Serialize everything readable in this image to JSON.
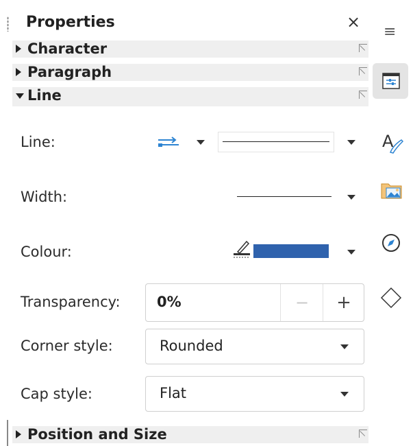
{
  "panel": {
    "title": "Properties",
    "close_label": "×"
  },
  "sections": {
    "character": "Character",
    "paragraph": "Paragraph",
    "line": "Line",
    "position_size": "Position and Size"
  },
  "line": {
    "line_label": "Line:",
    "width_label": "Width:",
    "colour_label": "Colour:",
    "colour_value": "#2f62ad",
    "transparency_label": "Transparency:",
    "transparency_value": "0%",
    "corner_label": "Corner style:",
    "corner_value": "Rounded",
    "cap_label": "Cap style:",
    "cap_value": "Flat"
  },
  "sidebar": {
    "menu_glyph": "≡",
    "icons": [
      "properties-icon",
      "styles-icon",
      "gallery-icon",
      "navigator-icon",
      "shapes-icon"
    ]
  },
  "colors": {
    "accent": "#2d84d2",
    "section_bg": "#efefef"
  }
}
